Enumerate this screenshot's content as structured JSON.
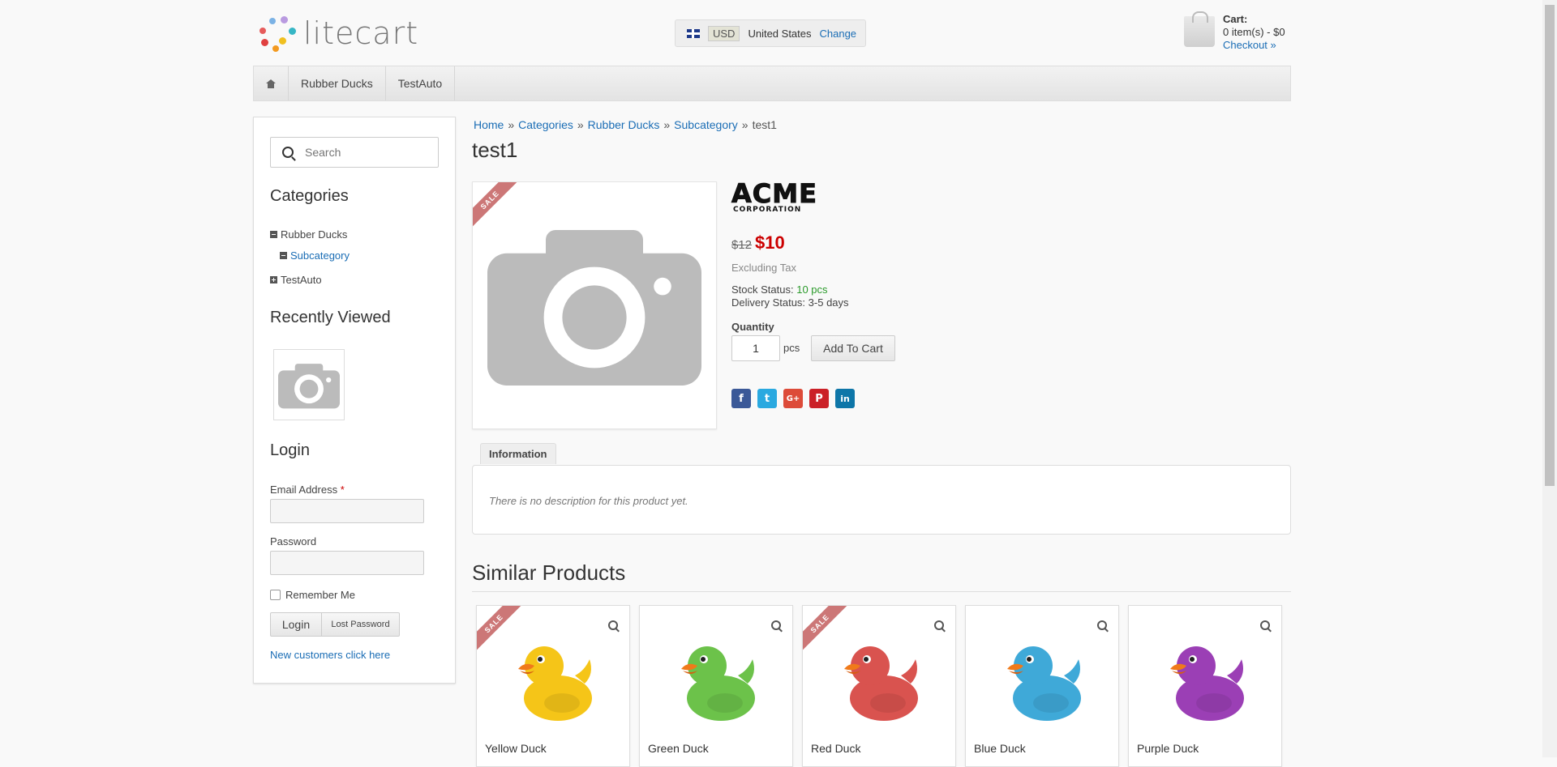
{
  "header": {
    "logo_text": "litecart",
    "region": {
      "currency": "USD",
      "country": "United States",
      "change_label": "Change"
    },
    "cart": {
      "title": "Cart:",
      "summary": "0 item(s) - $0",
      "checkout_label": "Checkout »"
    }
  },
  "nav": {
    "items": [
      "Rubber Ducks",
      "TestAuto"
    ]
  },
  "sidebar": {
    "search_placeholder": "Search",
    "categories_title": "Categories",
    "categories": [
      "Rubber Ducks",
      "Subcategory",
      "TestAuto"
    ],
    "recently_viewed_title": "Recently Viewed",
    "login": {
      "title": "Login",
      "email_label": "Email Address",
      "required_mark": "*",
      "password_label": "Password",
      "remember_label": "Remember Me",
      "login_button": "Login",
      "lost_password_button": "Lost Password",
      "new_customers_link": "New customers click here"
    }
  },
  "breadcrumb": [
    "Home",
    "Categories",
    "Rubber Ducks",
    "Subcategory",
    "test1"
  ],
  "breadcrumb_sep": "»",
  "product": {
    "title": "test1",
    "sale_badge": "SALE",
    "brand": "ACME",
    "brand_sub": "CORPORATION",
    "old_price": "$12",
    "price": "$10",
    "tax_note": "Excluding Tax",
    "stock_label": "Stock Status:",
    "stock_value": "10 pcs",
    "delivery_label": "Delivery Status:",
    "delivery_value": "3-5 days",
    "quantity_label": "Quantity",
    "quantity_value": "1",
    "unit": "pcs",
    "add_to_cart": "Add To Cart",
    "social": [
      {
        "name": "facebook",
        "glyph": "f",
        "color": "#3b5998"
      },
      {
        "name": "twitter",
        "glyph": "t",
        "color": "#2aa9e0"
      },
      {
        "name": "google-plus",
        "glyph": "G+",
        "color": "#dd4b39"
      },
      {
        "name": "pinterest",
        "glyph": "P",
        "color": "#cb2027"
      },
      {
        "name": "linkedin",
        "glyph": "in",
        "color": "#0e76a8"
      }
    ]
  },
  "tabs": {
    "information_label": "Information",
    "description": "There is no description for this product yet."
  },
  "similar": {
    "title": "Similar Products",
    "products": [
      {
        "name": "Yellow Duck",
        "color": "#f5c518",
        "sale": true
      },
      {
        "name": "Green Duck",
        "color": "#6cc24a",
        "sale": false
      },
      {
        "name": "Red Duck",
        "color": "#d9534f",
        "sale": true
      },
      {
        "name": "Blue Duck",
        "color": "#3fa9d8",
        "sale": false
      },
      {
        "name": "Purple Duck",
        "color": "#9b3fb5",
        "sale": false
      }
    ]
  }
}
